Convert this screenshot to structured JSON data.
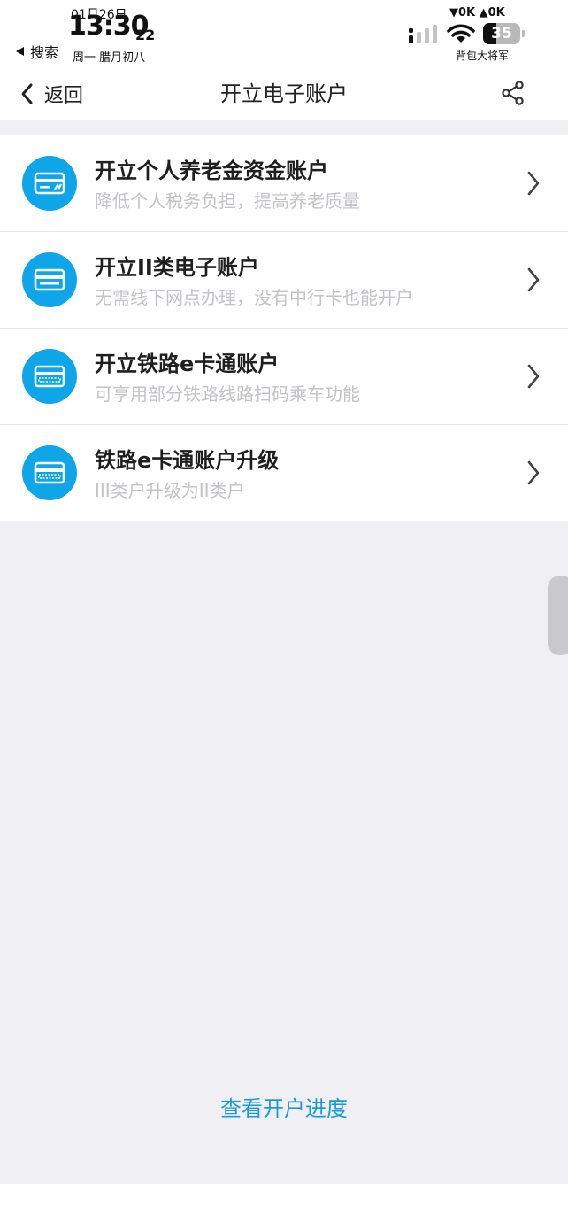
{
  "status_bar": {
    "date": "01月26日",
    "time": "13:30",
    "seconds": "22",
    "back_app": "搜索",
    "lunar": "周一 腊月初八",
    "network": "▼0K ▲0K",
    "battery": 35,
    "carrier": "背包大将军"
  },
  "nav": {
    "back_label": "返回",
    "title": "开立电子账户",
    "share_icon": "share-icon"
  },
  "items": [
    {
      "title": "开立个人养老金资金账户",
      "subtitle": "降低个人税务负担，提高养老质量",
      "icon": "pension-card-icon"
    },
    {
      "title": "开立II类电子账户",
      "subtitle": "无需线下网点办理，没有中行卡也能开户",
      "icon": "card-icon"
    },
    {
      "title": "开立铁路e卡通账户",
      "subtitle": "可享用部分铁路线路扫码乘车功能",
      "icon": "railway-card-icon"
    },
    {
      "title": "铁路e卡通账户升级",
      "subtitle": "III类户升级为II类户",
      "icon": "railway-card-icon"
    }
  ],
  "footer": {
    "progress_link": "查看开户进度"
  },
  "colors": {
    "accent": "#0ea5e9",
    "link": "#1a9bd7",
    "background": "#efeff4"
  }
}
